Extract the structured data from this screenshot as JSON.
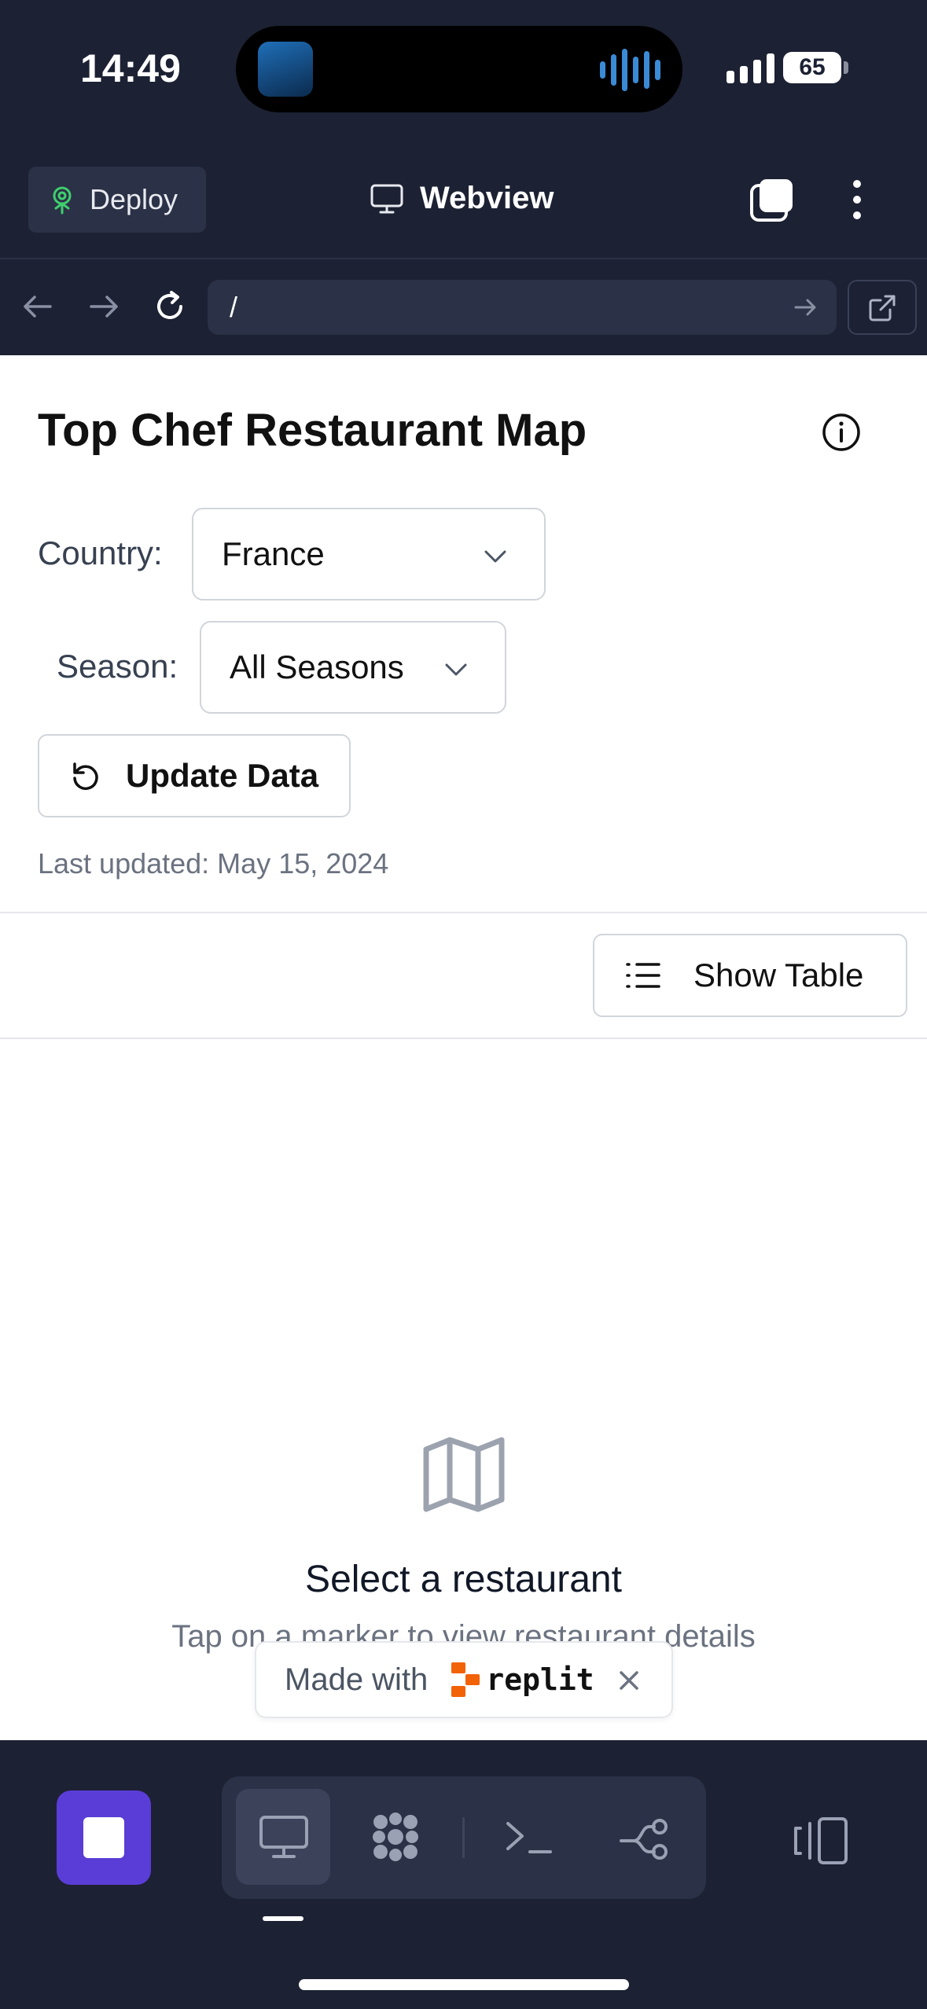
{
  "status_bar": {
    "time": "14:49",
    "battery": "65"
  },
  "app_bar": {
    "deploy_label": "Deploy",
    "title": "Webview"
  },
  "url_bar": {
    "url": "/"
  },
  "page": {
    "title": "Top Chef Restaurant Map",
    "country_label": "Country:",
    "country_value": "France",
    "season_label": "Season:",
    "season_value": "All Seasons",
    "update_button": "Update Data",
    "last_updated": "Last updated: May 15, 2024",
    "show_table_button": "Show Table",
    "empty_title": "Select a restaurant",
    "empty_subtitle": "Tap on a marker to view restaurant details"
  },
  "badge": {
    "made_with": "Made with",
    "brand": "replit"
  },
  "colors": {
    "accent": "#5a3dd6",
    "background": "#1c2133",
    "surface": "#2b3146",
    "replit_orange": "#f26207"
  },
  "icons": [
    "deploy-icon",
    "monitor-icon",
    "tabs-icon",
    "more-icon",
    "back-icon",
    "forward-icon",
    "reload-icon",
    "go-icon",
    "external-link-icon",
    "info-icon",
    "chevron-down-icon",
    "refresh-icon",
    "list-icon",
    "map-icon",
    "close-icon",
    "stop-icon",
    "webview-icon",
    "shell-icon",
    "console-icon",
    "git-icon",
    "panel-icon"
  ]
}
